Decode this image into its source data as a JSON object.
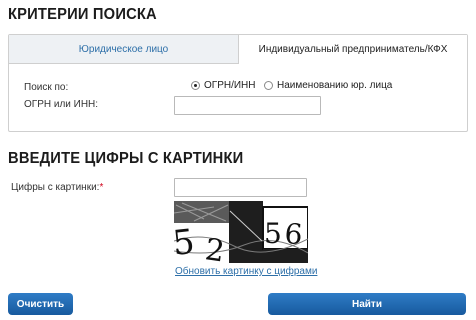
{
  "search_criteria": {
    "title": "КРИТЕРИИ ПОИСКА",
    "tabs": [
      {
        "label": "Юридическое лицо",
        "active": false
      },
      {
        "label": "Индивидуальный предприниматель/КФХ",
        "active": true
      }
    ],
    "search_by_label": "Поиск по:",
    "search_by_options": [
      {
        "label": "ОГРН/ИНН",
        "checked": true
      },
      {
        "label": "Наименованию юр. лица",
        "checked": false
      }
    ],
    "ogrn_inn_label": "ОГРН или ИНН:",
    "ogrn_inn_value": ""
  },
  "captcha": {
    "title": "ВВЕДИТЕ ЦИФРЫ С КАРТИНКИ",
    "input_label": "Цифры с картинки:",
    "required_mark": "*",
    "input_value": "",
    "image_text": "5256",
    "refresh_link": "Обновить картинку с цифрами"
  },
  "buttons": {
    "clear_label": "Очистить",
    "find_label": "Найти"
  },
  "colors": {
    "link": "#2d6fa8",
    "button": "#1f6bb5",
    "required": "#d0021b",
    "tab_inactive_bg": "#eef1f4"
  }
}
